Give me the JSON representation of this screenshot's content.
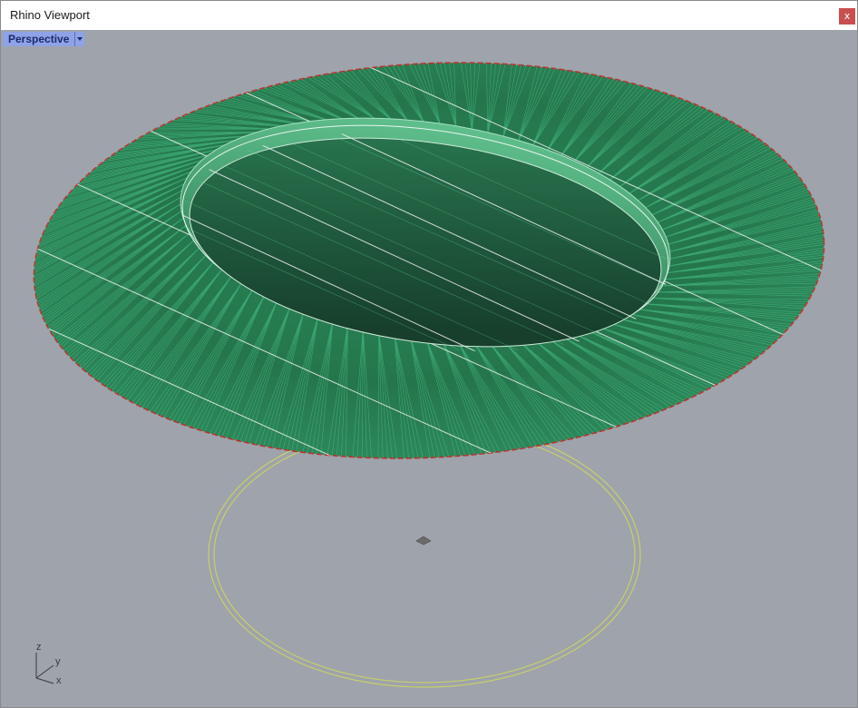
{
  "window": {
    "title": "Rhino Viewport",
    "close_label": "x"
  },
  "viewport": {
    "name": "Perspective"
  },
  "axes": {
    "z_label": "z",
    "y_label": "y",
    "x_label": "x"
  },
  "colors": {
    "viewport_background": "#9ea3ac",
    "surface_green": "#1f6b45",
    "surface_highlight": "#3fae78",
    "edge_red": "#b8332a",
    "curve_yellow": "#c8cf6a",
    "active_tab": "#8fa2e6",
    "close_button": "#c94f4f"
  }
}
